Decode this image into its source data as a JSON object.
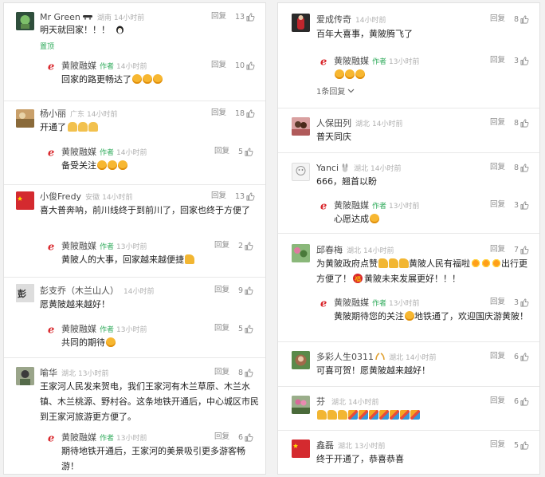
{
  "accent_color": "#2eaa5a",
  "like_icon": "thumbs-up-icon",
  "left": [
    {
      "comment": {
        "name": "Mr Green",
        "location": "湖南",
        "time": "14小时前",
        "reply": "回复",
        "likes": "13",
        "text": "明天就回家！！！",
        "pinned": "置顶"
      },
      "author_reply": {
        "name": "黄陂融媒",
        "author_tag": "作者",
        "time": "14小时前",
        "reply": "回复",
        "likes": "10",
        "text": "回家的路更畅达了"
      }
    },
    {
      "comment": {
        "name": "杨小丽",
        "location": "广东",
        "time": "14小时前",
        "reply": "回复",
        "likes": "18",
        "text": "开通了"
      },
      "author_reply": {
        "name": "黄陂融媒",
        "author_tag": "作者",
        "time": "14小时前",
        "reply": "回复",
        "likes": "5",
        "text": "备受关注"
      }
    },
    {
      "comment": {
        "name": "小俊Fredy",
        "location": "安徽",
        "time": "14小时前",
        "reply": "回复",
        "likes": "13",
        "text": "喜大普奔呐，前川线终于到前川了，回家也终于方便了"
      },
      "author_reply": {
        "name": "黄陂融媒",
        "author_tag": "作者",
        "time": "13小时前",
        "reply": "回复",
        "likes": "2",
        "text": "黄陂人的大事，回家越来越便捷"
      }
    },
    {
      "comment": {
        "name": "彭支乔（木兰山人）",
        "location": "",
        "time": "14小时前",
        "reply": "回复",
        "likes": "9",
        "text": "愿黄陂越来越好！"
      },
      "author_reply": {
        "name": "黄陂融媒",
        "author_tag": "作者",
        "time": "13小时前",
        "reply": "回复",
        "likes": "5",
        "text": "共同的期待"
      }
    },
    {
      "comment": {
        "name": "喻华",
        "location": "湖北",
        "time": "13小时前",
        "reply": "回复",
        "likes": "8",
        "text": "王家河人民发来贺电，我们王家河有木兰草原、木兰水镇、木兰桃源、野村谷。这条地铁开通后，中心城区市民到王家河旅游更方便了。"
      },
      "author_reply": {
        "name": "黄陂融媒",
        "author_tag": "作者",
        "time": "13小时前",
        "reply": "回复",
        "likes": "6",
        "text": "期待地铁开通后，王家河的美景吸引更多游客畅游！"
      }
    }
  ],
  "right": [
    {
      "comment": {
        "name": "爱成传奇",
        "location": "",
        "time": "14小时前",
        "reply": "回复",
        "likes": "8",
        "text": "百年大喜事，黄陂腾飞了"
      },
      "author_reply": {
        "name": "黄陂融媒",
        "author_tag": "作者",
        "time": "13小时前",
        "reply": "回复",
        "likes": "3",
        "text": ""
      },
      "more_replies": "1条回复"
    },
    {
      "comment": {
        "name": "人保田列",
        "location": "湖北",
        "time": "14小时前",
        "reply": "回复",
        "likes": "8",
        "text": "普天同庆"
      }
    },
    {
      "comment": {
        "name": "Yanci",
        "location": "湖北",
        "time": "14小时前",
        "reply": "回复",
        "likes": "8",
        "text": "666，翘首以盼"
      },
      "author_reply": {
        "name": "黄陂融媒",
        "author_tag": "作者",
        "time": "13小时前",
        "reply": "回复",
        "likes": "3",
        "text": "心愿达成"
      }
    },
    {
      "comment": {
        "name": "邱春梅",
        "location": "湖北",
        "time": "14小时前",
        "reply": "回复",
        "likes": "7",
        "text_a": "为黄陂政府点赞",
        "text_b": "黄陂人民有福啦",
        "text_c": "出行更方便了！",
        "text_d": "黄陂未来发展更好！！！"
      },
      "author_reply": {
        "name": "黄陂融媒",
        "author_tag": "作者",
        "time": "13小时前",
        "reply": "回复",
        "likes": "3",
        "text_a": "黄陂期待您的关注",
        "text_b": "地铁通了，欢迎国庆游黄陂！"
      }
    },
    {
      "comment": {
        "name": "多彩人生0311",
        "location": "湖北",
        "time": "14小时前",
        "reply": "回复",
        "likes": "6",
        "text": "可喜可贺！愿黄陂越来越好！"
      }
    },
    {
      "comment": {
        "name": "芬",
        "location": "湖北",
        "time": "14小时前",
        "reply": "回复",
        "likes": "6",
        "text": ""
      }
    },
    {
      "comment": {
        "name": "鑫磊",
        "location": "湖北",
        "time": "13小时前",
        "reply": "回复",
        "likes": "5",
        "text": "终于开通了，恭喜恭喜"
      }
    }
  ]
}
